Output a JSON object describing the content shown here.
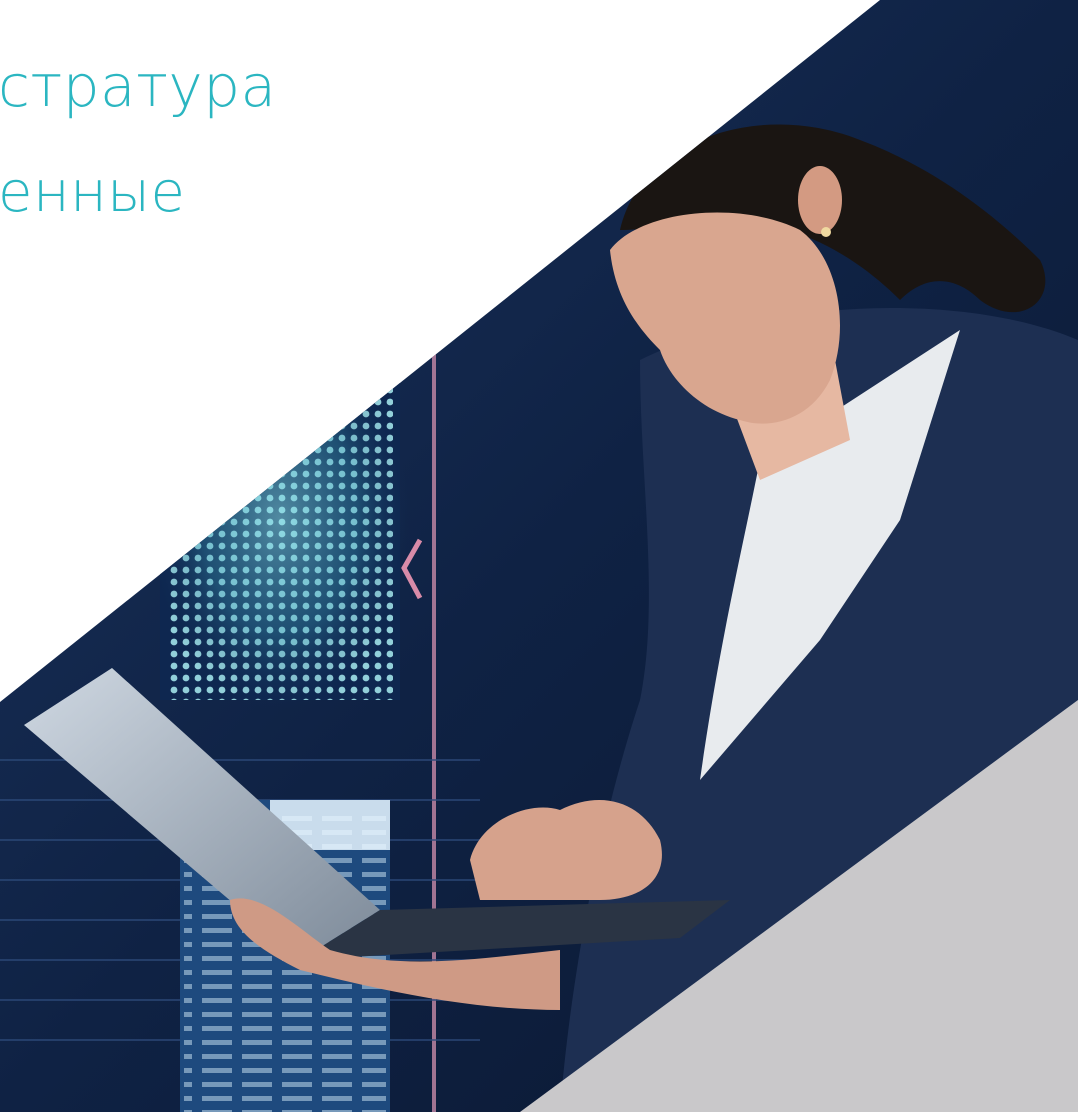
{
  "headline": {
    "line1": "стратура",
    "line2": "енные"
  },
  "colors": {
    "accent": "#2bb6c1",
    "background": "#ffffff",
    "corner_panel": "#c9c8ca",
    "scene_dark": "#0d1f3c",
    "scene_navy": "#152a4e"
  },
  "image": {
    "subject": "woman-typing-on-laptop",
    "setting": "server-room-data-display"
  }
}
